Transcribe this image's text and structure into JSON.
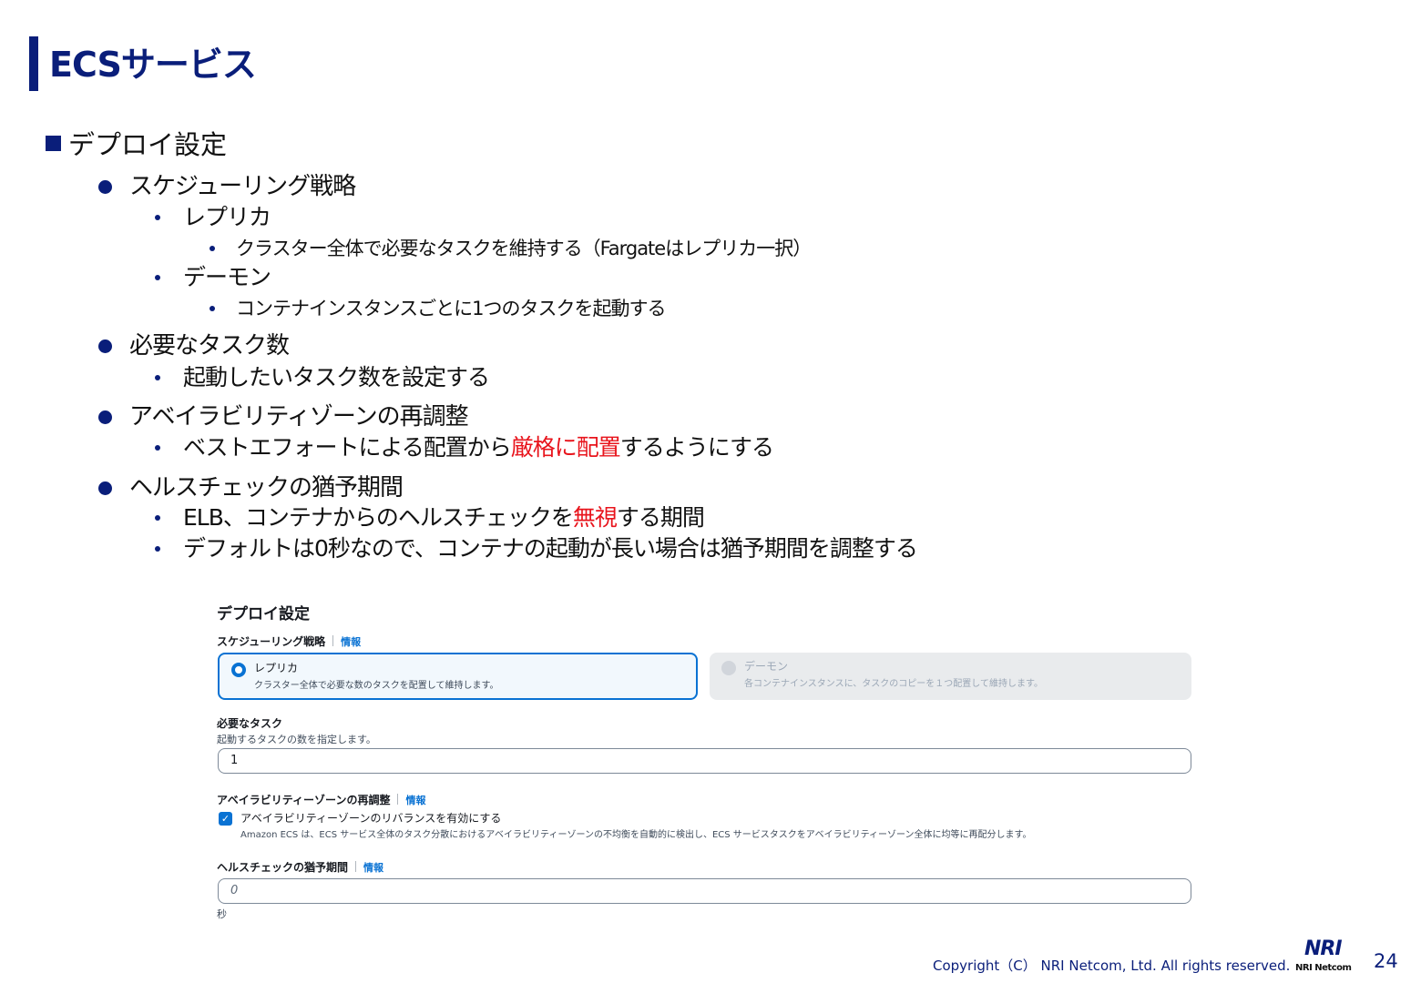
{
  "slide": {
    "title": "ECSサービス",
    "section": "デプロイ設定",
    "items": [
      {
        "text": "スケジューリング戦略"
      },
      {
        "text": "レプリカ"
      },
      {
        "text": "クラスター全体で必要なタスクを維持する（Fargateはレプリカ一択）"
      },
      {
        "text": "デーモン"
      },
      {
        "text": "コンテナインスタンスごとに1つのタスクを起動する"
      },
      {
        "text": "必要なタスク数"
      },
      {
        "text": "起動したいタスク数を設定する"
      },
      {
        "text": "アベイラビリティゾーンの再調整"
      },
      {
        "pre": "ベストエフォートによる配置から",
        "red": "厳格に配置",
        "post": "するようにする"
      },
      {
        "text": "ヘルスチェックの猶予期間"
      },
      {
        "pre": "ELB、コンテナからのヘルスチェックを",
        "red": "無視",
        "post": "する期間"
      },
      {
        "text": "デフォルトは0秒なので、コンテナの起動が長い場合は猶予期間を調整する"
      }
    ]
  },
  "screenshot": {
    "title": "デプロイ設定",
    "scheduling": {
      "label": "スケジューリング戦略",
      "info": "情報",
      "replica_title": "レプリカ",
      "replica_desc": "クラスター全体で必要な数のタスクを配置して維持します。",
      "daemon_title": "デーモン",
      "daemon_desc": "各コンテナインスタンスに、タスクのコピーを１つ配置して維持します。"
    },
    "tasks": {
      "label": "必要なタスク",
      "desc": "起動するタスクの数を指定します。",
      "value": "1"
    },
    "az": {
      "label": "アベイラビリティーゾーンの再調整",
      "info": "情報",
      "checkbox_label": "アベイラビリティーゾーンのリバランスを有効にする",
      "checkbox_desc": "Amazon ECS は、ECS サービス全体のタスク分散におけるアベイラビリティーゾーンの不均衡を自動的に検出し、ECS サービスタスクをアベイラビリティーゾーン全体に均等に再配分します。"
    },
    "grace": {
      "label": "ヘルスチェックの猶予期間",
      "info": "情報",
      "placeholder": "0",
      "unit": "秒"
    }
  },
  "footer": {
    "copyright": "Copyright（C） NRI Netcom, Ltd. All rights reserved.",
    "logo_text": "NRI",
    "logo_sub": "NRI Netcom",
    "page": "24"
  }
}
